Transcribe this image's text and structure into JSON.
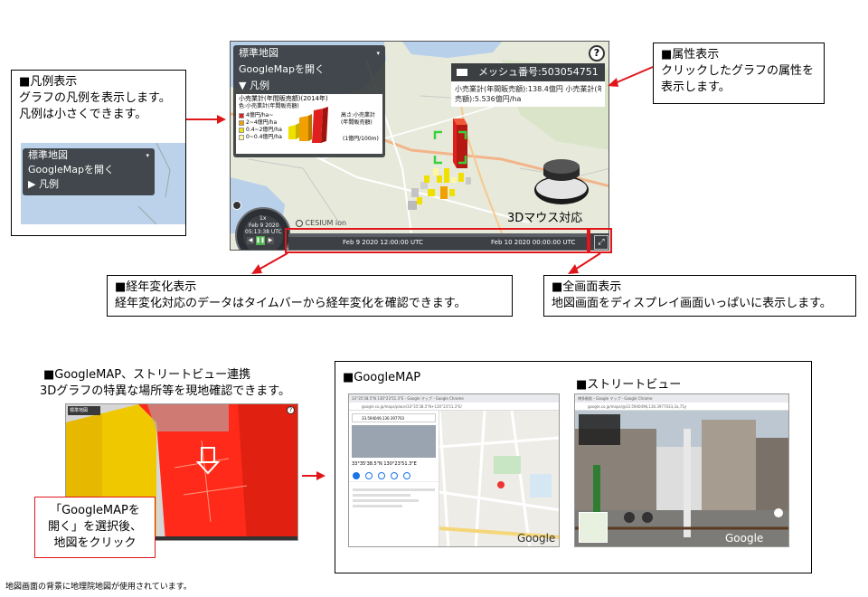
{
  "legend_callout": {
    "heading": "■凡例表示",
    "line1": "グラフの凡例を表示します。",
    "line2": "凡例は小さくできます。"
  },
  "attribute_callout": {
    "heading": "■属性表示",
    "line1": "クリックしたグラフの属性を",
    "line2": "表示します。"
  },
  "timeline_callout": {
    "heading": "■経年変化表示",
    "line1": "経年変化対応のデータはタイムバーから経年変化を確認できます。"
  },
  "fullscreen_callout": {
    "heading": "■全画面表示",
    "line1": "地図画面をディスプレイ画面いっぱいに表示します。"
  },
  "googlemap_link": {
    "heading": "■GoogleMAP、ストリートビュー連携",
    "line1": "3Dグラフの特異な場所等を現地確認できます。"
  },
  "red_note": {
    "line1": "「GoogleMAPを",
    "line2": "開く」を選択後、",
    "line3": "地図をクリック"
  },
  "gmap_section": {
    "googlemap_heading": "■GoogleMAP",
    "streetview_heading": "■ストリートビュー"
  },
  "footnote": "地図画面の背景に地理院地図が使用されています。",
  "map_ui": {
    "menu_base": "標準地図",
    "menu_google": "GoogleMapを開く",
    "menu_legend_open": "▼ 凡例",
    "menu_legend_closed": "▶ 凡例",
    "legend_title": "小売業計(年間販売額)(2014年)",
    "legend_sub": "色:小売業計(年間販売額)",
    "legend_items": [
      "4億円/ha~",
      "2~4億円/ha",
      "0.4~2億円/ha",
      "0~0.4億円/ha"
    ],
    "legend_height_label": "高さ:小売業計(年間販売額)",
    "legend_height_value": "(1億円/100m)",
    "legend_colors": [
      "#e0201c",
      "#f0a000",
      "#f0e000",
      "#fff8a0"
    ],
    "help_icon": "?",
    "mesh_label": "メッシュ番号:503054751",
    "mesh_detail_line1": "小売業計(年間販売額):138.4億円 小売業計(年間販",
    "mesh_detail_line2": "売額):5.536億円/ha",
    "mouse_label": "3Dマウス対応",
    "cesium_label": "CESIUM ion",
    "clock_speed": "1x",
    "clock_date": "Feb 9 2020",
    "clock_time": "05:13:38 UTC",
    "time_start": "Feb 9 2020 12:00:00 UTC",
    "time_end": "Feb 10 2020 00:00:00 UTC"
  },
  "google_ui": {
    "coords": "33°35'38.5\"N 130°23'51.3\"E",
    "search_value": "33.594049,130.397703",
    "brand": "Google"
  },
  "colors": {
    "accent_red": "#e0161b",
    "panel_dark": "#303336"
  }
}
